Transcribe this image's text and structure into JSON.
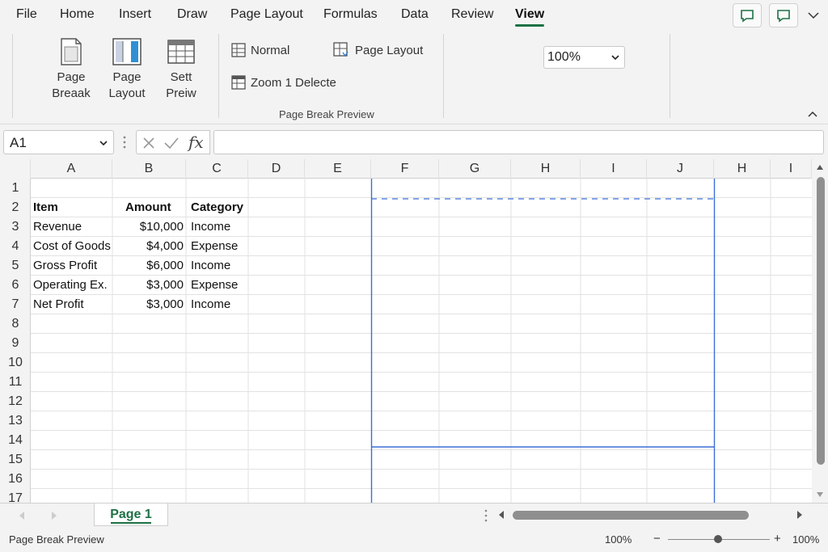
{
  "menu": {
    "items": [
      {
        "label": "File",
        "active": false
      },
      {
        "label": "Home",
        "active": false
      },
      {
        "label": "Insert",
        "active": false
      },
      {
        "label": "Draw",
        "active": false
      },
      {
        "label": "Page Layout",
        "active": false
      },
      {
        "label": "Formulas",
        "active": false
      },
      {
        "label": "Data",
        "active": false
      },
      {
        "label": "Review",
        "active": false
      },
      {
        "label": "View",
        "active": true
      }
    ],
    "icons": [
      "comments-icon",
      "comment-icon",
      "chevron-down-icon"
    ]
  },
  "ribbon": {
    "big_buttons": [
      {
        "line1": "Page",
        "line2": "Breaak"
      },
      {
        "line1": "Page",
        "line2": "Layout"
      },
      {
        "line1": "Sett",
        "line2": "Preiw"
      }
    ],
    "small_buttons": {
      "normal": "Normal",
      "page_layout": "Page Layout",
      "zoom": "Zoom 1 Delecte"
    },
    "group_label": "Page Break Preview",
    "zoom_value": "100%"
  },
  "formula_bar": {
    "name_box": "A1",
    "fx_label": "fx",
    "formula": ""
  },
  "grid": {
    "column_headers": [
      "A",
      "B",
      "C",
      "D",
      "E",
      "F",
      "G",
      "H",
      "I",
      "J",
      "H",
      "I"
    ],
    "row_headers": [
      "1",
      "2",
      "3",
      "4",
      "5",
      "6",
      "7",
      "8",
      "9",
      "10",
      "11",
      "12",
      "13",
      "14",
      "15",
      "16",
      "17"
    ],
    "table": {
      "headers": [
        "Item",
        "Amount",
        "Category"
      ],
      "rows": [
        [
          "Revenue",
          "$10,000",
          "Income"
        ],
        [
          "Cost of Goods",
          "$4,000",
          "Expense"
        ],
        [
          "Gross Profit",
          "$6,000",
          "Income"
        ],
        [
          "Operating Ex.",
          "$3,000",
          "Expense"
        ],
        [
          "Net Profit",
          "$3,000",
          "Income"
        ]
      ]
    },
    "page_break_color": "#3b6fd6"
  },
  "sheet_tabs": {
    "tabs": [
      "Page 1"
    ],
    "active": "Page 1",
    "accent": "#1e7145"
  },
  "status_bar": {
    "mode": "Page Break Preview",
    "zoom_left": "100%",
    "zoom_right": "100%",
    "zoom_minus": "−",
    "zoom_plus": "+"
  }
}
